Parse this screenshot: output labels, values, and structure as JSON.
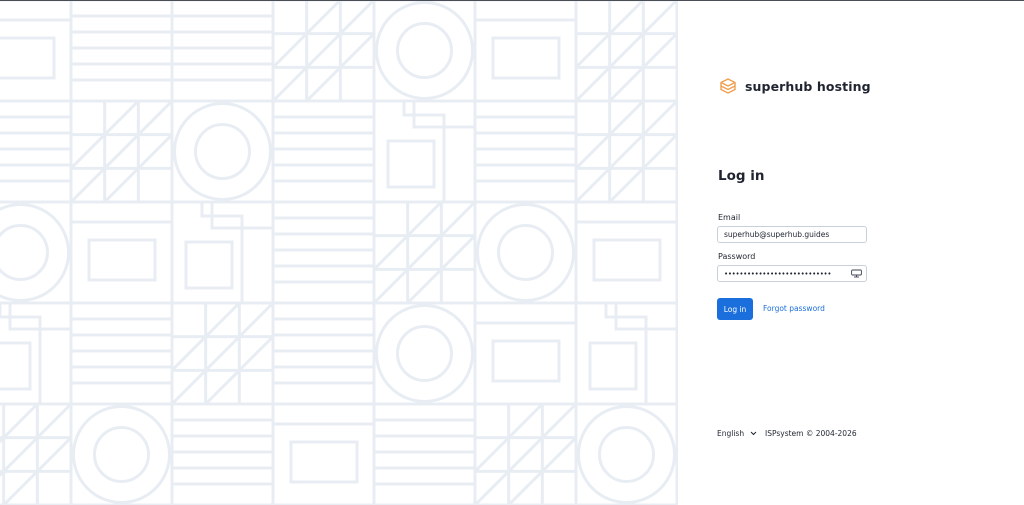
{
  "brand": {
    "name": "superhub hosting",
    "logo_icon": "server-stack-icon",
    "accent": "#f0a050"
  },
  "login": {
    "title": "Log in",
    "email_label": "Email",
    "email_value": "superhub@superhub.guides",
    "password_label": "Password",
    "password_value": "••••••••••••••••••••••••••••",
    "submit_label": "Log in",
    "forgot_label": "Forgot password"
  },
  "footer": {
    "language": "English",
    "copyright": "ISPsystem © 2004-2026"
  },
  "colors": {
    "primary": "#1a6fdc",
    "pattern_stroke": "#e8edf4"
  }
}
